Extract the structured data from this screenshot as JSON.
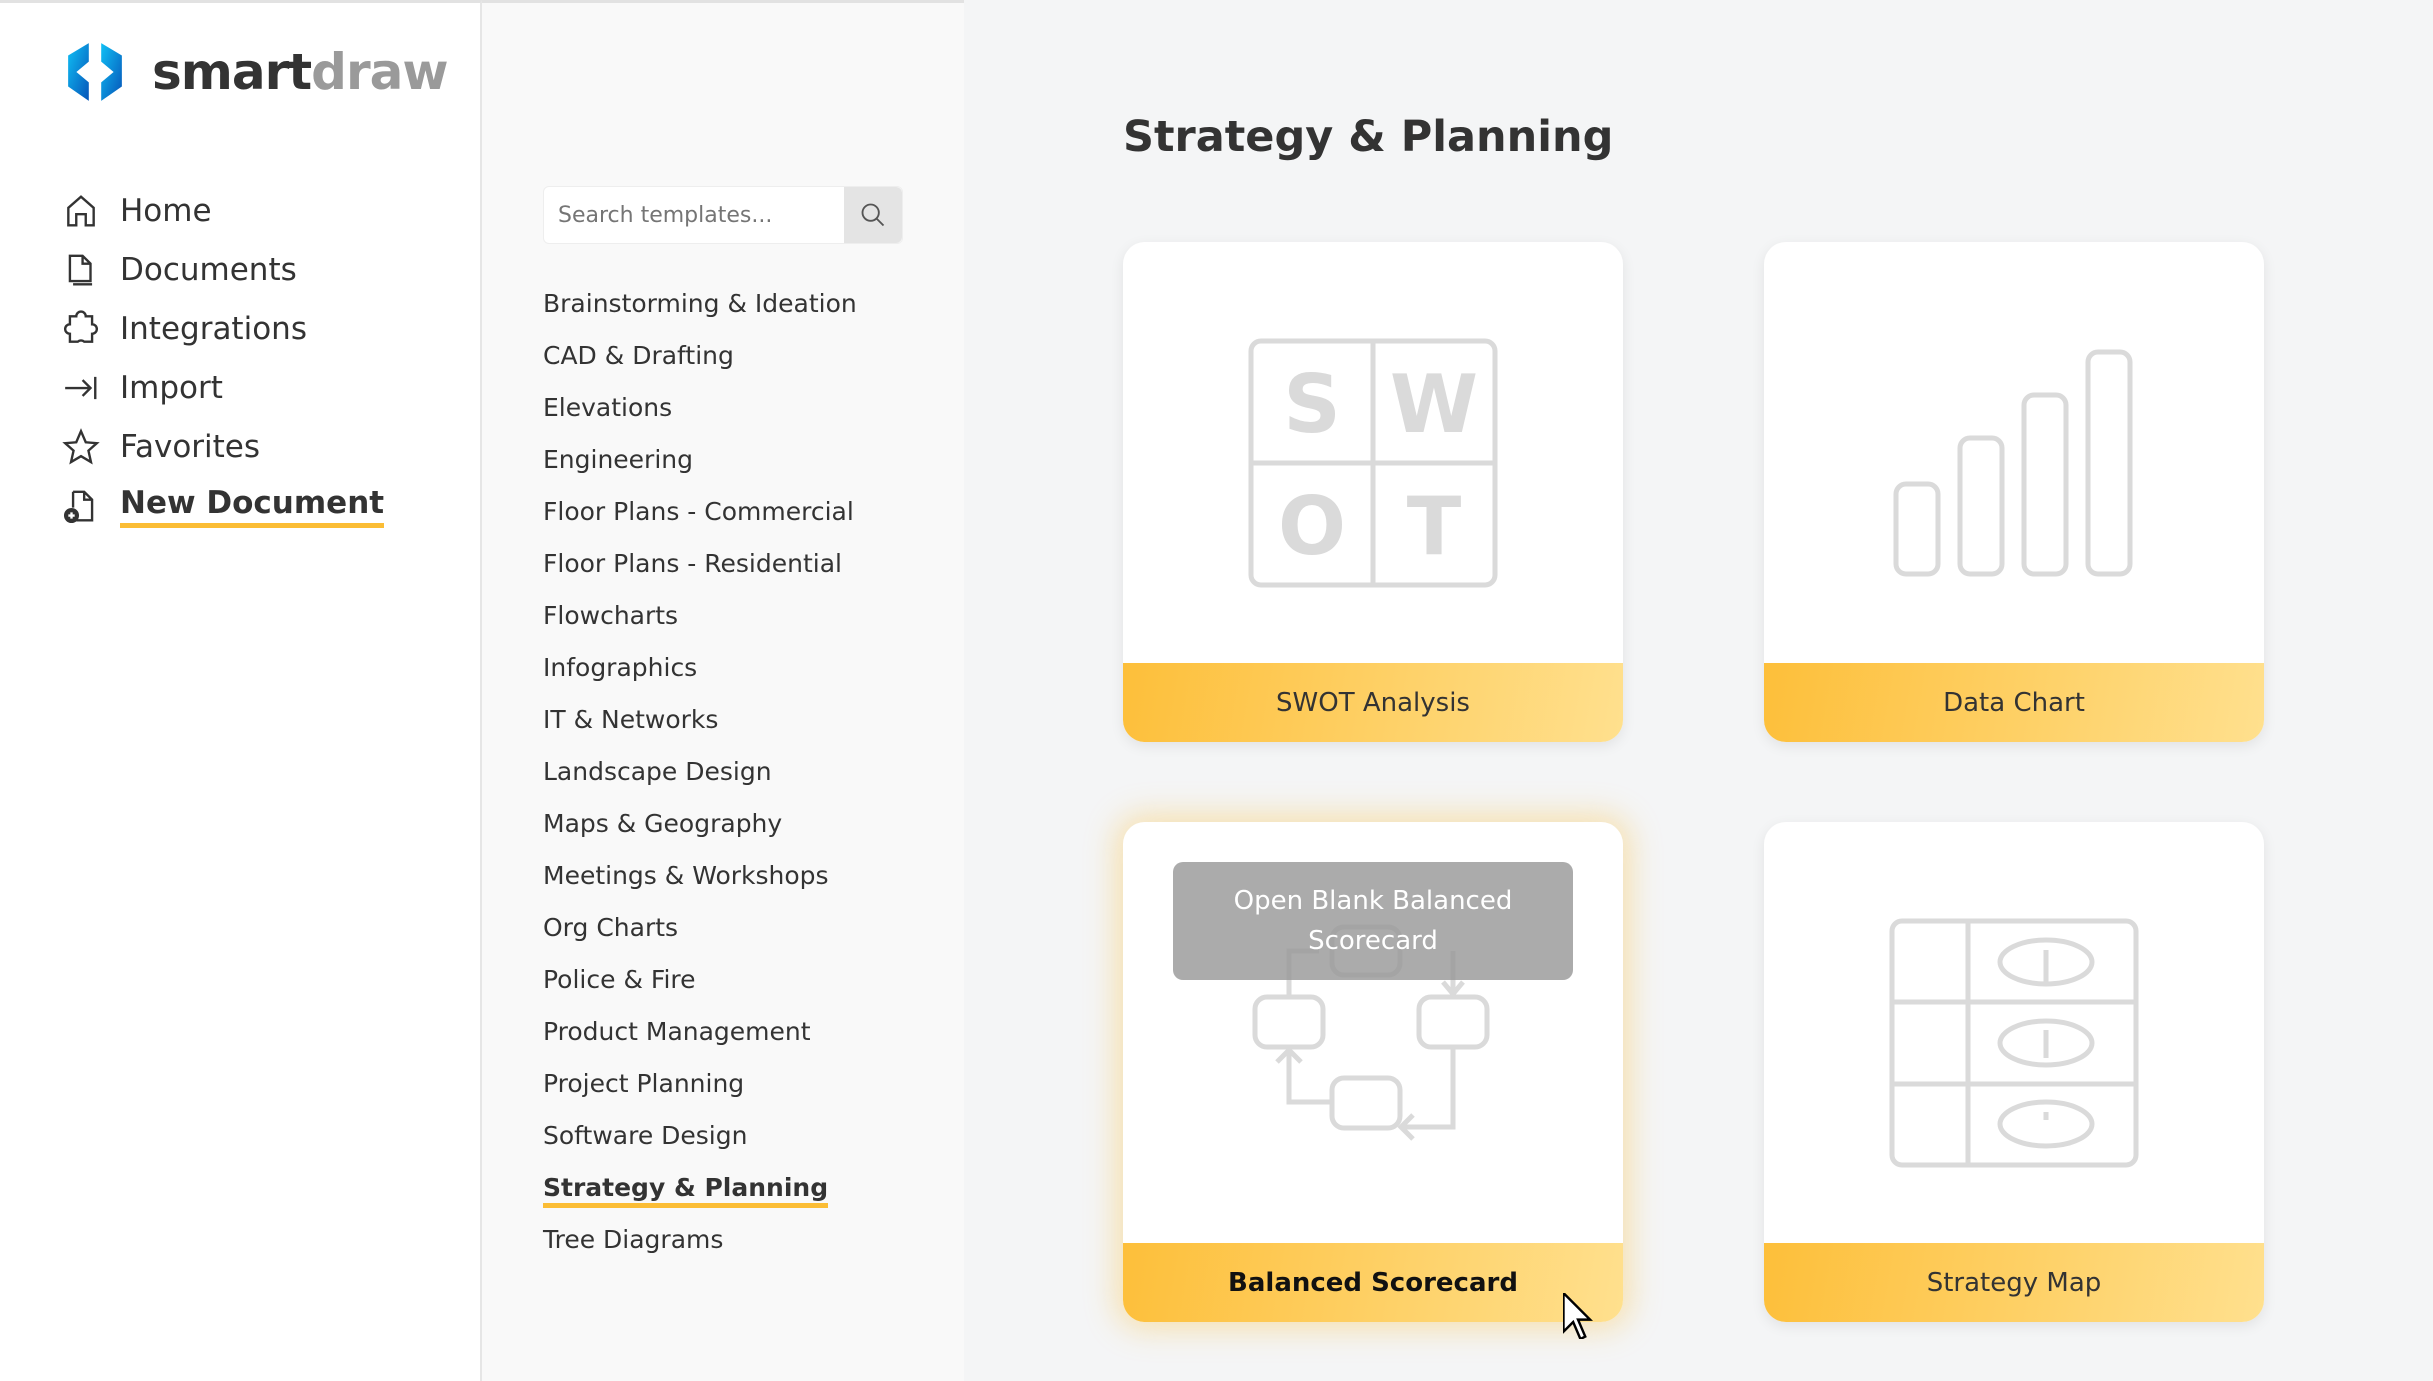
{
  "brand": {
    "name_part1": "smart",
    "name_part2": "draw"
  },
  "nav": [
    {
      "label": "Home",
      "icon": "home-icon"
    },
    {
      "label": "Documents",
      "icon": "documents-icon"
    },
    {
      "label": "Integrations",
      "icon": "puzzle-icon"
    },
    {
      "label": "Import",
      "icon": "import-icon"
    },
    {
      "label": "Favorites",
      "icon": "star-icon"
    },
    {
      "label": "New Document",
      "icon": "new-document-icon",
      "active": true
    }
  ],
  "search": {
    "placeholder": "Search templates...",
    "value": ""
  },
  "categories": [
    "Brainstorming & Ideation",
    "CAD & Drafting",
    "Elevations",
    "Engineering",
    "Floor Plans - Commercial",
    "Floor Plans - Residential",
    "Flowcharts",
    "Infographics",
    "IT & Networks",
    "Landscape Design",
    "Maps & Geography",
    "Meetings & Workshops",
    "Org Charts",
    "Police & Fire",
    "Product Management",
    "Project Planning",
    "Software Design",
    "Strategy & Planning",
    "Tree Diagrams"
  ],
  "active_category": "Strategy & Planning",
  "main": {
    "title": "Strategy & Planning",
    "cards": [
      {
        "label": "SWOT Analysis",
        "letters": [
          "S",
          "W",
          "O",
          "T"
        ]
      },
      {
        "label": "Data Chart"
      },
      {
        "label": "Balanced Scorecard",
        "overlay": "Open Blank Balanced Scorecard"
      },
      {
        "label": "Strategy Map"
      }
    ]
  },
  "colors": {
    "accent": "#fbbd35",
    "logo_blue": "#0a7bd6",
    "thumb_gray": "#dadada"
  }
}
